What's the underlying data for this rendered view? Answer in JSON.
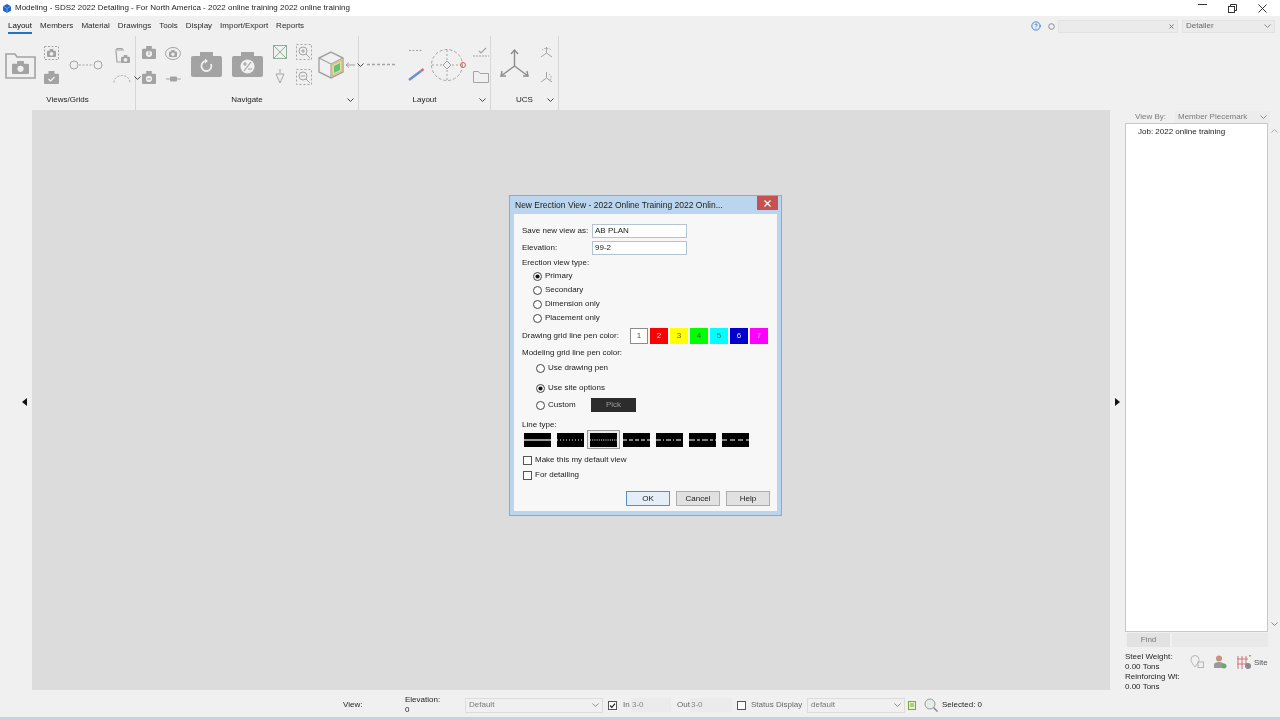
{
  "window": {
    "title": "Modeling - SDS2 2022 Detailing - For North America - 2022 online training 2022 online training"
  },
  "ribbon_tabs": [
    {
      "label": "Layout",
      "selected": true
    },
    {
      "label": "Members",
      "selected": false
    },
    {
      "label": "Material",
      "selected": false
    },
    {
      "label": "Drawings",
      "selected": false
    },
    {
      "label": "Tools",
      "selected": false
    },
    {
      "label": "Display",
      "selected": false
    },
    {
      "label": "Import/Export",
      "selected": false
    },
    {
      "label": "Reports",
      "selected": false
    }
  ],
  "role_select": {
    "value": "Detailer"
  },
  "ribbon_groups": [
    {
      "label": "Views/Grids",
      "dropdown": false
    },
    {
      "label": "Navigate",
      "dropdown": true
    },
    {
      "label": "Layout",
      "dropdown": true
    },
    {
      "label": "UCS",
      "dropdown": true
    }
  ],
  "dialog": {
    "title": "New Erection View - 2022 Online Training 2022 Onlin...",
    "fields": [
      {
        "label": "Save new view as:",
        "value": "AB PLAN"
      },
      {
        "label": "Elevation:",
        "value": "99-2"
      }
    ],
    "view_type_label": "Erection view type:",
    "view_types": [
      {
        "label": "Primary",
        "selected": true
      },
      {
        "label": "Secondary",
        "selected": false
      },
      {
        "label": "Dimension only",
        "selected": false
      },
      {
        "label": "Placement only",
        "selected": false
      }
    ],
    "pen_color_label": "Drawing grid line pen color:",
    "pen_colors": [
      {
        "label": "1",
        "color": "#ffffff"
      },
      {
        "label": "2",
        "color": "#ff0000"
      },
      {
        "label": "3",
        "color": "#ffff00"
      },
      {
        "label": "4",
        "color": "#00ff00"
      },
      {
        "label": "5",
        "color": "#00ffff"
      },
      {
        "label": "6",
        "color": "#0000cc"
      },
      {
        "label": "7",
        "color": "#ff00ff"
      }
    ],
    "modeling_pen_label": "Modeling grid line pen color:",
    "modeling_pen_options": [
      {
        "label": "Use drawing pen",
        "selected": false
      },
      {
        "label": "Use site options",
        "selected": true
      },
      {
        "label": "Custom",
        "selected": false,
        "pick_button": {
          "label": "Pick",
          "disabled": true
        }
      }
    ],
    "line_type_label": "Line type:",
    "line_types": [
      {
        "kind": "solid",
        "selected": false
      },
      {
        "kind": "dotted",
        "selected": false
      },
      {
        "kind": "fine_dotted",
        "selected": true
      },
      {
        "kind": "dashed",
        "selected": false
      },
      {
        "kind": "dash_dot",
        "selected": false
      },
      {
        "kind": "dash_dash",
        "selected": false
      },
      {
        "kind": "long_dash",
        "selected": false
      }
    ],
    "checkboxes": [
      {
        "label": "Make this my default view",
        "checked": false
      },
      {
        "label": "For detailing",
        "checked": false
      }
    ],
    "buttons": [
      {
        "label": "OK",
        "default": true
      },
      {
        "label": "Cancel",
        "default": false
      },
      {
        "label": "Help",
        "default": false
      }
    ]
  },
  "right_panel": {
    "view_by_label": "View By:",
    "view_by_value": "Member Piecemark",
    "tree": [
      {
        "label": "Job: 2022 online training"
      }
    ],
    "find_button": "Find",
    "stats": [
      {
        "label": "Steel Weight:",
        "value": "0.00 Tons"
      },
      {
        "label": "Reinforcing Wt:",
        "value": "0.00 Tons"
      }
    ],
    "site_button": "Site"
  },
  "status_bar": {
    "view_label": "View:",
    "elevation_label": "Elevation:",
    "elevation_value": "0",
    "view_select": "Default",
    "in_checked": true,
    "in_label": "In",
    "in_value": "3-0",
    "out_label": "Out",
    "out_value": "3-0",
    "status_display_checked": false,
    "status_display_label": "Status Display",
    "display_select": "default",
    "selected_label": "Selected: 0"
  }
}
